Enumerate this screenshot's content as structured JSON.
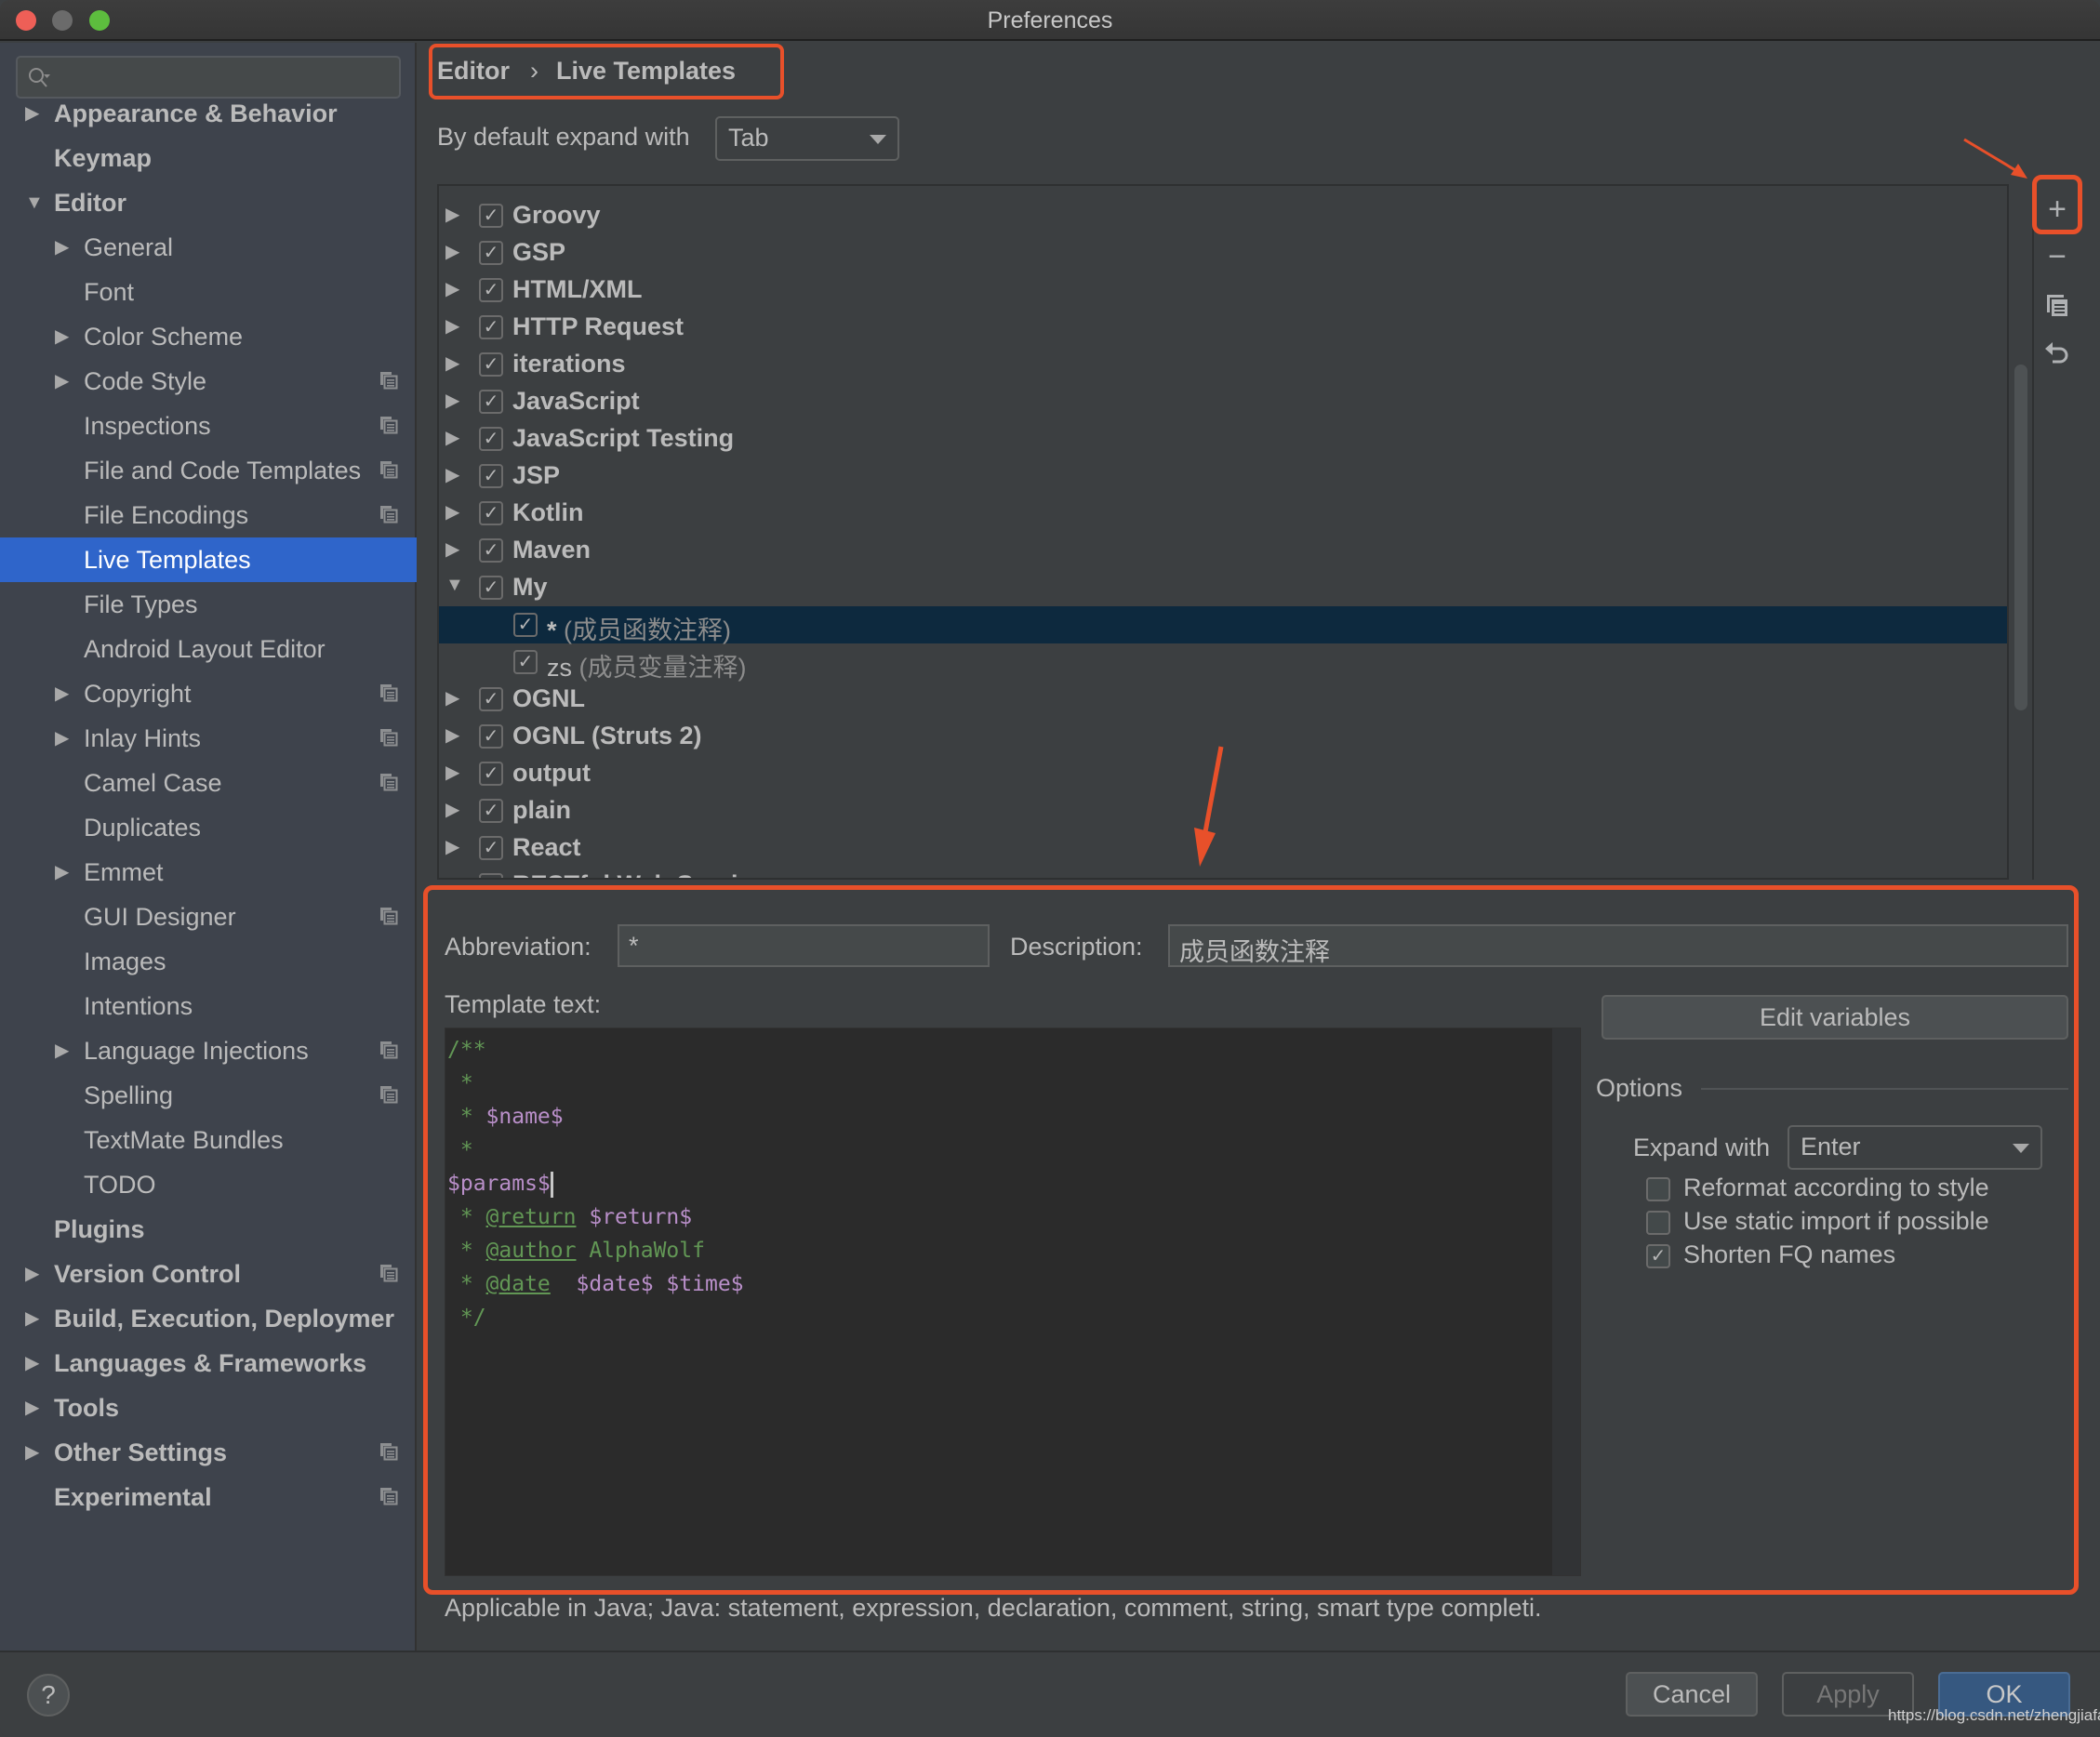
{
  "window": {
    "title": "Preferences"
  },
  "sidebar": {
    "search_placeholder": "",
    "items": [
      {
        "label": "Appearance & Behavior",
        "level": 0,
        "bold": true,
        "arrow": "right",
        "project_icon": false
      },
      {
        "label": "Keymap",
        "level": 0,
        "bold": true,
        "arrow": "none",
        "project_icon": false
      },
      {
        "label": "Editor",
        "level": 0,
        "bold": true,
        "arrow": "down",
        "project_icon": false
      },
      {
        "label": "General",
        "level": 1,
        "bold": false,
        "arrow": "right",
        "project_icon": false
      },
      {
        "label": "Font",
        "level": 1,
        "bold": false,
        "arrow": "none",
        "project_icon": false
      },
      {
        "label": "Color Scheme",
        "level": 1,
        "bold": false,
        "arrow": "right",
        "project_icon": false
      },
      {
        "label": "Code Style",
        "level": 1,
        "bold": false,
        "arrow": "right",
        "project_icon": true
      },
      {
        "label": "Inspections",
        "level": 1,
        "bold": false,
        "arrow": "none",
        "project_icon": true
      },
      {
        "label": "File and Code Templates",
        "level": 1,
        "bold": false,
        "arrow": "none",
        "project_icon": true
      },
      {
        "label": "File Encodings",
        "level": 1,
        "bold": false,
        "arrow": "none",
        "project_icon": true
      },
      {
        "label": "Live Templates",
        "level": 1,
        "bold": false,
        "arrow": "none",
        "project_icon": false,
        "selected": true
      },
      {
        "label": "File Types",
        "level": 1,
        "bold": false,
        "arrow": "none",
        "project_icon": false
      },
      {
        "label": "Android Layout Editor",
        "level": 1,
        "bold": false,
        "arrow": "none",
        "project_icon": false
      },
      {
        "label": "Copyright",
        "level": 1,
        "bold": false,
        "arrow": "right",
        "project_icon": true
      },
      {
        "label": "Inlay Hints",
        "level": 1,
        "bold": false,
        "arrow": "right",
        "project_icon": true
      },
      {
        "label": "Camel Case",
        "level": 1,
        "bold": false,
        "arrow": "none",
        "project_icon": true
      },
      {
        "label": "Duplicates",
        "level": 1,
        "bold": false,
        "arrow": "none",
        "project_icon": false
      },
      {
        "label": "Emmet",
        "level": 1,
        "bold": false,
        "arrow": "right",
        "project_icon": false
      },
      {
        "label": "GUI Designer",
        "level": 1,
        "bold": false,
        "arrow": "none",
        "project_icon": true
      },
      {
        "label": "Images",
        "level": 1,
        "bold": false,
        "arrow": "none",
        "project_icon": false
      },
      {
        "label": "Intentions",
        "level": 1,
        "bold": false,
        "arrow": "none",
        "project_icon": false
      },
      {
        "label": "Language Injections",
        "level": 1,
        "bold": false,
        "arrow": "right",
        "project_icon": true
      },
      {
        "label": "Spelling",
        "level": 1,
        "bold": false,
        "arrow": "none",
        "project_icon": true
      },
      {
        "label": "TextMate Bundles",
        "level": 1,
        "bold": false,
        "arrow": "none",
        "project_icon": false
      },
      {
        "label": "TODO",
        "level": 1,
        "bold": false,
        "arrow": "none",
        "project_icon": false
      },
      {
        "label": "Plugins",
        "level": 0,
        "bold": true,
        "arrow": "none",
        "project_icon": false
      },
      {
        "label": "Version Control",
        "level": 0,
        "bold": true,
        "arrow": "right",
        "project_icon": true
      },
      {
        "label": "Build, Execution, Deploymer",
        "level": 0,
        "bold": true,
        "arrow": "right",
        "project_icon": false
      },
      {
        "label": "Languages & Frameworks",
        "level": 0,
        "bold": true,
        "arrow": "right",
        "project_icon": false
      },
      {
        "label": "Tools",
        "level": 0,
        "bold": true,
        "arrow": "right",
        "project_icon": false
      },
      {
        "label": "Other Settings",
        "level": 0,
        "bold": true,
        "arrow": "right",
        "project_icon": true
      },
      {
        "label": "Experimental",
        "level": 0,
        "bold": true,
        "arrow": "none",
        "project_icon": true
      }
    ]
  },
  "breadcrumb": {
    "parent": "Editor",
    "separator": "›",
    "current": "Live Templates"
  },
  "expand_default": {
    "label": "By default expand with",
    "value": "Tab"
  },
  "template_groups": [
    {
      "name": "Groovy",
      "checked": true,
      "expanded": false
    },
    {
      "name": "GSP",
      "checked": true,
      "expanded": false
    },
    {
      "name": "HTML/XML",
      "checked": true,
      "expanded": false
    },
    {
      "name": "HTTP Request",
      "checked": true,
      "expanded": false
    },
    {
      "name": "iterations",
      "checked": true,
      "expanded": false
    },
    {
      "name": "JavaScript",
      "checked": true,
      "expanded": false
    },
    {
      "name": "JavaScript Testing",
      "checked": true,
      "expanded": false
    },
    {
      "name": "JSP",
      "checked": true,
      "expanded": false
    },
    {
      "name": "Kotlin",
      "checked": true,
      "expanded": false
    },
    {
      "name": "Maven",
      "checked": true,
      "expanded": false
    },
    {
      "name": "My",
      "checked": true,
      "expanded": true,
      "children": [
        {
          "abbr": "*",
          "desc": "(成员函数注释)",
          "checked": true,
          "selected": true
        },
        {
          "abbr": "zs",
          "desc": "(成员变量注释)",
          "checked": true,
          "selected": false
        }
      ]
    },
    {
      "name": "OGNL",
      "checked": true,
      "expanded": false
    },
    {
      "name": "OGNL (Struts 2)",
      "checked": true,
      "expanded": false
    },
    {
      "name": "output",
      "checked": true,
      "expanded": false
    },
    {
      "name": "plain",
      "checked": true,
      "expanded": false
    },
    {
      "name": "React",
      "checked": true,
      "expanded": false
    },
    {
      "name": "RESTful Web Services",
      "checked": true,
      "expanded": false
    }
  ],
  "toolbar": {
    "add": {
      "icon": "plus-icon",
      "glyph": "+"
    },
    "remove": {
      "icon": "minus-icon",
      "glyph": "−"
    },
    "copy": {
      "icon": "copy-icon"
    },
    "restore": {
      "icon": "undo-icon",
      "glyph": "↶"
    }
  },
  "detail": {
    "abbreviation_label": "Abbreviation:",
    "abbreviation_value": "*",
    "description_label": "Description:",
    "description_value": "成员函数注释",
    "template_text_label": "Template text:",
    "template_lines": [
      [
        {
          "t": "/**",
          "c": "green"
        }
      ],
      [
        {
          "t": " *",
          "c": "green"
        }
      ],
      [
        {
          "t": " * ",
          "c": "green"
        },
        {
          "t": "$name$",
          "c": "var"
        }
      ],
      [
        {
          "t": " *",
          "c": "green"
        }
      ],
      [
        {
          "t": "$params$",
          "c": "var"
        },
        {
          "t": "",
          "c": "caret"
        }
      ],
      [
        {
          "t": " * ",
          "c": "green"
        },
        {
          "t": "@return",
          "c": "tag"
        },
        {
          "t": " ",
          "c": "green"
        },
        {
          "t": "$return$",
          "c": "var"
        }
      ],
      [
        {
          "t": " * ",
          "c": "green"
        },
        {
          "t": "@author",
          "c": "tag"
        },
        {
          "t": " AlphaWolf",
          "c": "green"
        }
      ],
      [
        {
          "t": " * ",
          "c": "green"
        },
        {
          "t": "@date",
          "c": "tag"
        },
        {
          "t": "  ",
          "c": "green"
        },
        {
          "t": "$date$ $time$",
          "c": "var"
        }
      ],
      [
        {
          "t": " */",
          "c": "green"
        }
      ]
    ],
    "edit_variables_label": "Edit variables",
    "options_label": "Options",
    "expand_with_label": "Expand with",
    "expand_with_value": "Enter",
    "options": [
      {
        "label": "Reformat according to style",
        "checked": false
      },
      {
        "label": "Use static import if possible",
        "checked": false
      },
      {
        "label": "Shorten FQ names",
        "checked": true
      }
    ]
  },
  "footer": {
    "applicable_text": "Applicable in Java; Java: statement, expression, declaration, comment, string, smart type completi.",
    "help_label": "?",
    "cancel_label": "Cancel",
    "apply_label": "Apply",
    "ok_label": "OK"
  },
  "watermark": "https://blog.csdn.net/zhengjiafa",
  "colors": {
    "highlight_annotation": "#e8502a",
    "sidebar_selected": "#2f65ca",
    "tree_selected": "#0d293e",
    "ok_button": "#365880",
    "code_green": "#629755",
    "code_var": "#b98fc9"
  }
}
